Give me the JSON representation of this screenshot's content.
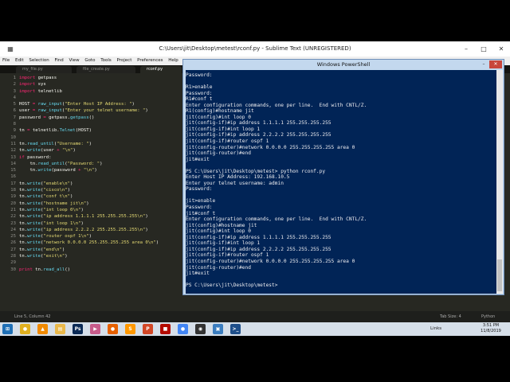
{
  "sublime": {
    "title": "C:\\Users\\jit\\Desktop\\metest\\rconf.py - Sublime Text (UNREGISTERED)",
    "menu": [
      "File",
      "Edit",
      "Selection",
      "Find",
      "View",
      "Goto",
      "Tools",
      "Project",
      "Preferences",
      "Help"
    ],
    "tabs": [
      "my_file.py",
      "file_create.py",
      "rconf.py"
    ],
    "line_numbers": [
      "1",
      "2",
      "3",
      "4",
      "5",
      "6",
      "7",
      "8",
      "9",
      "10",
      "11",
      "12",
      "13",
      "14",
      "15",
      "16",
      "17",
      "18",
      "19",
      "20",
      "21",
      "22",
      "23",
      "24",
      "25",
      "26",
      "27",
      "28",
      "29",
      "30"
    ],
    "status_left": "Line 5, Column 42",
    "status_tab": "Tab Size: 4",
    "status_lang": "Python"
  },
  "code": [
    [
      "import getpass"
    ],
    [
      "import sys"
    ],
    [
      "import telnetlib"
    ],
    [
      ""
    ],
    [
      "HOST = raw_input(\"Enter Host IP Address: \")"
    ],
    [
      "user = raw_input(\"Enter your telnet username: \")"
    ],
    [
      "password = getpass.getpass()"
    ],
    [
      ""
    ],
    [
      "tn = telnetlib.Telnet(HOST)"
    ],
    [
      ""
    ],
    [
      "tn.read_until(\"Username: \")"
    ],
    [
      "tn.write(user + \"\\n\")"
    ],
    [
      "if password:"
    ],
    [
      "    tn.read_until(\"Password: \")"
    ],
    [
      "    tn.write(password + \"\\n\")"
    ],
    [
      ""
    ],
    [
      "tn.write(\"enable\\n\")"
    ],
    [
      "tn.write(\"cisco\\n\")"
    ],
    [
      "tn.write(\"conf t\\n\")"
    ],
    [
      "tn.write(\"hostname jit\\n\")"
    ],
    [
      "tn.write(\"int loop 0\\n\")"
    ],
    [
      "tn.write(\"ip address 1.1.1.1 255.255.255.255\\n\")"
    ],
    [
      "tn.write(\"int loop 1\\n\")"
    ],
    [
      "tn.write(\"ip address 2.2.2.2 255.255.255.255\\n\")"
    ],
    [
      "tn.write(\"router ospf 1\\n\")"
    ],
    [
      "tn.write(\"network 0.0.0.0 255.255.255.255 area 0\\n\")"
    ],
    [
      "tn.write(\"end\\n\")"
    ],
    [
      "tn.write(\"exit\\n\")"
    ],
    [
      ""
    ],
    [
      "print tn.read_all()"
    ]
  ],
  "powershell": {
    "title": "Windows PowerShell",
    "lines": [
      "Password:",
      "",
      "R1>enable",
      "Password:",
      "R1#conf t",
      "Enter configuration commands, one per line.  End with CNTL/Z.",
      "R1(config)#hostname jit",
      "jit(config)#int loop 0",
      "jit(config-if)#ip address 1.1.1.1 255.255.255.255",
      "jit(config-if)#int loop 1",
      "jit(config-if)#ip address 2.2.2.2 255.255.255.255",
      "jit(config-if)#router ospf 1",
      "jit(config-router)#network 0.0.0.0 255.255.255.255 area 0",
      "jit(config-router)#end",
      "jit#exit",
      "",
      "PS C:\\Users\\jit\\Desktop\\metest> python rconf.py",
      "Enter Host IP Address: 192.168.10.5",
      "Enter your telnet username: admin",
      "Password:",
      "",
      "jit>enable",
      "Password:",
      "jit#conf t",
      "Enter configuration commands, one per line.  End with CNTL/Z.",
      "jit(config)#hostname jit",
      "jit(config)#int loop 0",
      "jit(config-if)#ip address 1.1.1.1 255.255.255.255",
      "jit(config-if)#int loop 1",
      "jit(config-if)#ip address 2.2.2.2 255.255.255.255",
      "jit(config-if)#router ospf 1",
      "jit(config-router)#network 0.0.0.0 255.255.255.255 area 0",
      "jit(config-router)#end",
      "jit#exit",
      "",
      "PS C:\\Users\\jit\\Desktop\\metest>"
    ]
  },
  "taskbar": {
    "icons": [
      "windows-start-icon",
      "chrome-icon",
      "vlc-icon",
      "file-explorer-icon",
      "photoshop-icon",
      "media-icon",
      "firefox-icon",
      "sublime-text-icon",
      "powerpoint-icon",
      "pdf-icon",
      "chrome-alt-icon",
      "obs-icon",
      "network-tool-icon",
      "powershell-icon"
    ],
    "links_label": "Links",
    "time": "3:51 PM",
    "date": "11/8/2019"
  },
  "colors": {
    "editor_bg": "#272822",
    "keyword": "#f92672",
    "function": "#66d9ef",
    "string": "#e6db74",
    "powershell_bg": "#012456"
  }
}
